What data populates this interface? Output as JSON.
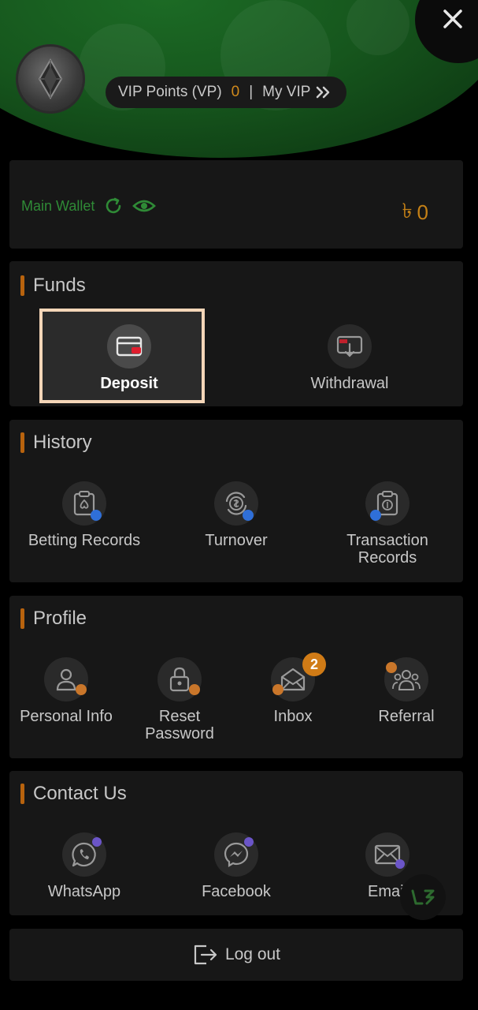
{
  "header": {
    "vip_points_label": "VIP Points (VP)",
    "vip_points_value": "0",
    "separator": "|",
    "my_vip_label": "My VIP"
  },
  "wallet": {
    "label": "Main Wallet",
    "currency_symbol": "৳",
    "balance": "0"
  },
  "funds": {
    "title": "Funds",
    "items": [
      {
        "label": "Deposit"
      },
      {
        "label": "Withdrawal"
      }
    ]
  },
  "history": {
    "title": "History",
    "items": [
      {
        "label": "Betting Records"
      },
      {
        "label": "Turnover"
      },
      {
        "label": "Transaction\nRecords"
      }
    ]
  },
  "profile": {
    "title": "Profile",
    "items": [
      {
        "label": "Personal Info"
      },
      {
        "label": "Reset\nPassword"
      },
      {
        "label": "Inbox",
        "badge": "2"
      },
      {
        "label": "Referral"
      }
    ]
  },
  "contact": {
    "title": "Contact Us",
    "items": [
      {
        "label": "WhatsApp"
      },
      {
        "label": "Facebook"
      },
      {
        "label": "Email"
      }
    ]
  },
  "logout": {
    "label": "Log out"
  },
  "colors": {
    "accent_orange": "#d08a1c",
    "wallet_green": "#2f8a36",
    "header_green": "#1c6b25",
    "highlight_border": "#f5d6b8"
  },
  "icons": {
    "close": "close-icon",
    "my_vip": "double-chevron-right-icon",
    "refresh": "refresh-icon",
    "eye": "eye-icon"
  }
}
